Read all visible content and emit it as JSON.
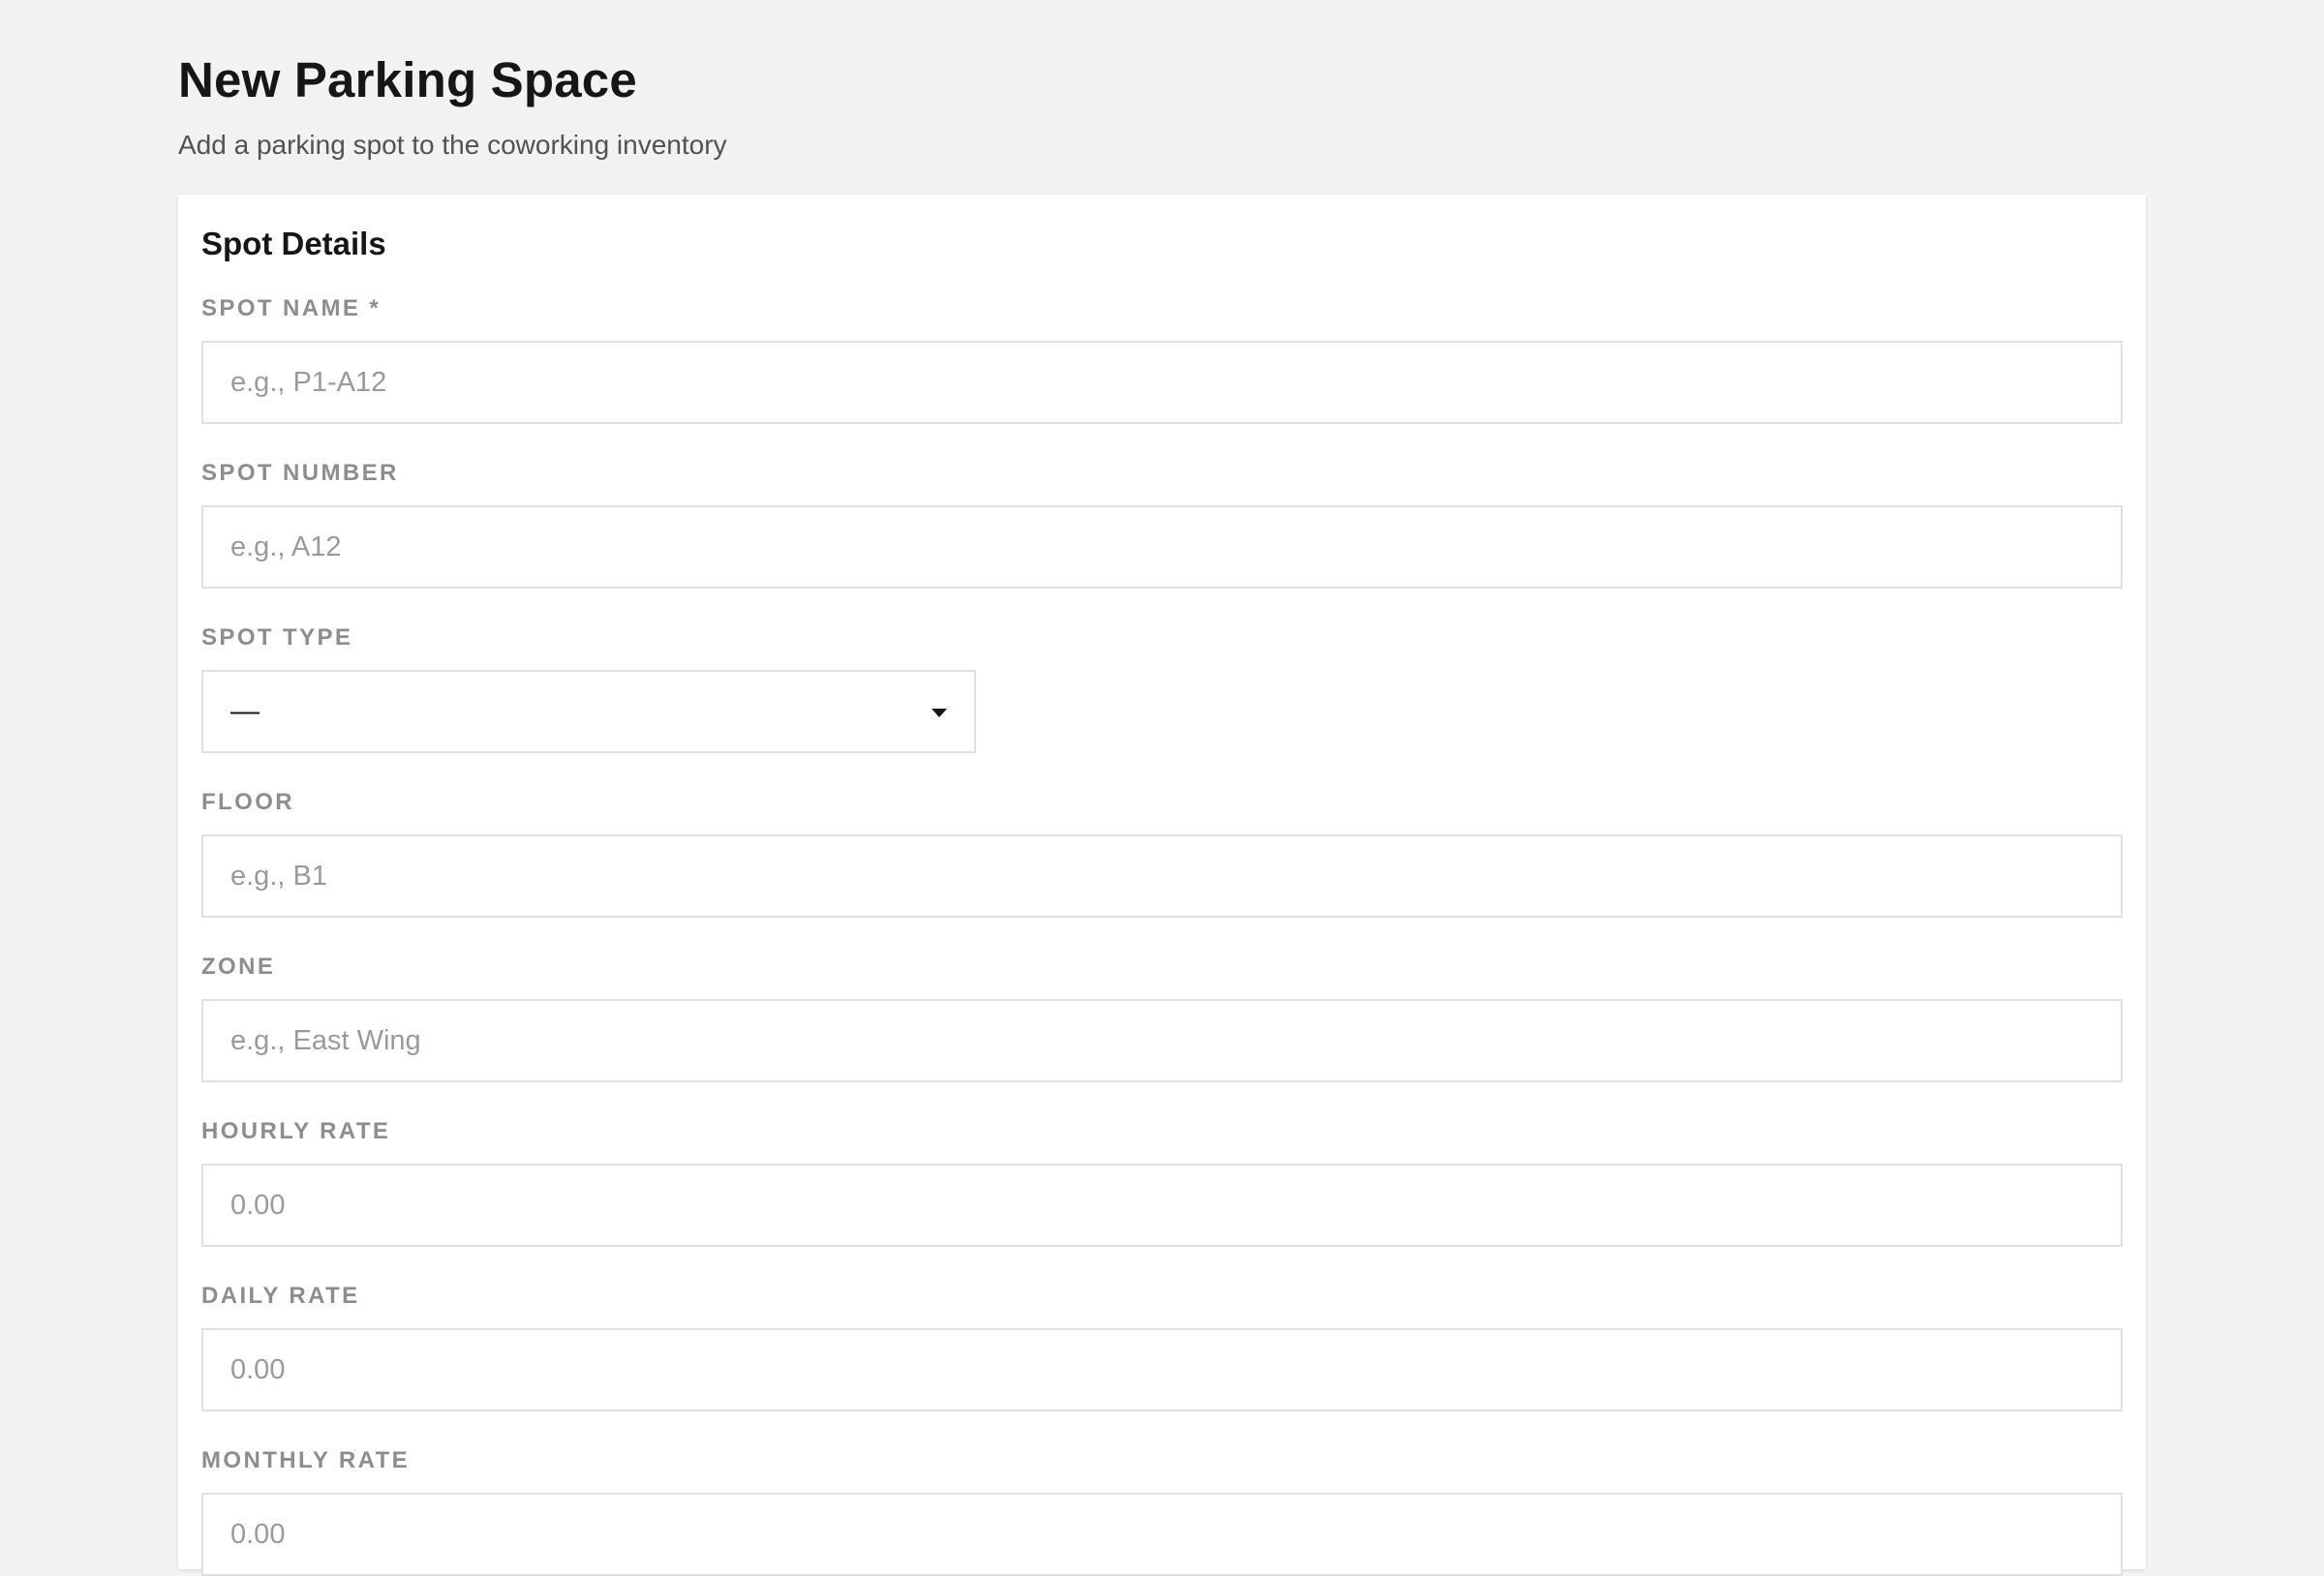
{
  "page": {
    "title": "New Parking Space",
    "subtitle": "Add a parking spot to the coworking inventory"
  },
  "form": {
    "section_title": "Spot Details",
    "spot_name": {
      "label": "SPOT NAME *",
      "placeholder": "e.g., P1-A12",
      "value": ""
    },
    "spot_number": {
      "label": "SPOT NUMBER",
      "placeholder": "e.g., A12",
      "value": ""
    },
    "spot_type": {
      "label": "SPOT TYPE",
      "selected": "—"
    },
    "floor": {
      "label": "FLOOR",
      "placeholder": "e.g., B1",
      "value": ""
    },
    "zone": {
      "label": "ZONE",
      "placeholder": "e.g., East Wing",
      "value": ""
    },
    "hourly_rate": {
      "label": "HOURLY RATE",
      "placeholder": "0.00",
      "value": ""
    },
    "daily_rate": {
      "label": "DAILY RATE",
      "placeholder": "0.00",
      "value": ""
    },
    "monthly_rate": {
      "label": "MONTHLY RATE",
      "placeholder": "0.00",
      "value": ""
    }
  },
  "colors": {
    "background": "#f2f2f2",
    "card": "#ffffff",
    "text_primary": "#161616",
    "text_secondary": "#525252",
    "label": "#8d8d8d",
    "placeholder": "#9a9a9a",
    "input_border": "#e0e0e0"
  },
  "icons": {
    "spot_type_dropdown": "caret-down-icon"
  }
}
